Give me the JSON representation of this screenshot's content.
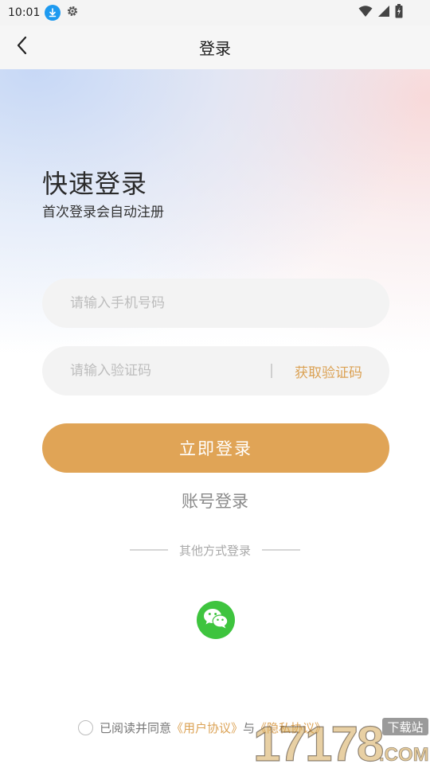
{
  "status_bar": {
    "time": "10:01"
  },
  "nav": {
    "title": "登录"
  },
  "hero": {
    "title": "快速登录",
    "subtitle": "首次登录会自动注册"
  },
  "phone": {
    "placeholder": "请输入手机号码",
    "value": ""
  },
  "code": {
    "placeholder": "请输入验证码",
    "value": "",
    "get_code_label": "获取验证码"
  },
  "login_button": "立即登录",
  "account_login": "账号登录",
  "other_methods": "其他方式登录",
  "agreement": {
    "prefix": "已阅读并同意",
    "user_agreement": "《用户协议》",
    "connector": "与",
    "privacy_policy": "《隐私协议》"
  },
  "watermark": {
    "number": "17178",
    "site": "下载站",
    "tld": ".COM"
  },
  "colors": {
    "accent": "#e0a456",
    "link": "#dba255",
    "wechat": "#3ec43e",
    "download_badge": "#1e9af0"
  }
}
